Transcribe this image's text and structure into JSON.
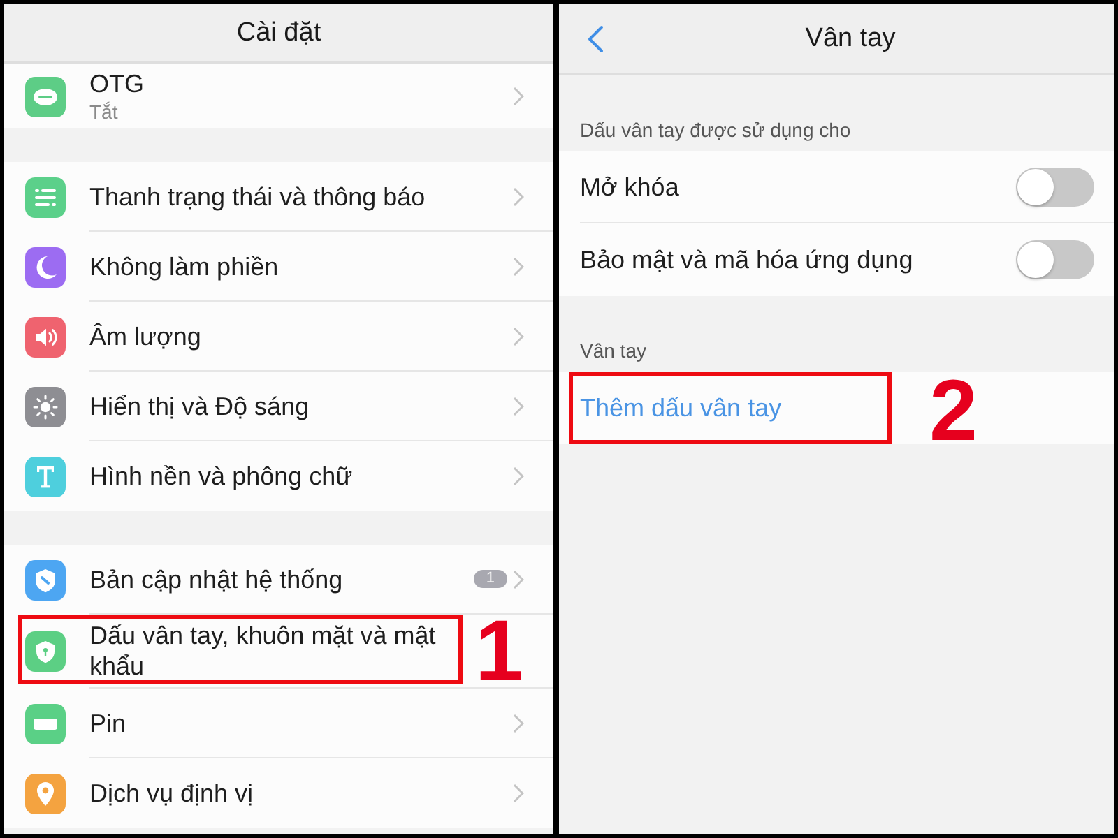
{
  "settings": {
    "title": "Cài đặt",
    "groups": [
      {
        "items": [
          {
            "label": "OTG",
            "sublabel": "Tắt",
            "color": "#5dcd86",
            "highlighted": false
          }
        ]
      },
      {
        "items": [
          {
            "label": "Thanh trạng thái và thông báo",
            "color": "#5bd08a",
            "highlighted": false
          },
          {
            "label": "Không làm phiền",
            "color": "#9c6cf2",
            "highlighted": false
          },
          {
            "label": "Âm lượng",
            "color": "#ef636f",
            "highlighted": false
          },
          {
            "label": "Hiển thị và Độ sáng",
            "color": "#8e8e93",
            "highlighted": false
          },
          {
            "label": "Hình nền và phông chữ",
            "color": "#4ecfdd",
            "highlighted": false
          }
        ]
      },
      {
        "items": [
          {
            "label": "Bản cập nhật hệ thống",
            "badge": "1",
            "color": "#4da6f2",
            "highlighted": false
          },
          {
            "label": "Dấu vân tay, khuôn mặt và mật khẩu",
            "color": "#5ccf84",
            "highlighted": true,
            "marker": "1"
          },
          {
            "label": "Pin",
            "color": "#5ad086",
            "highlighted": false
          },
          {
            "label": "Dịch vụ định vị",
            "color": "#f4a340",
            "highlighted": false
          }
        ]
      }
    ]
  },
  "fingerprint": {
    "title": "Vân tay",
    "sections": [
      {
        "header": "Dấu vân tay được sử dụng cho",
        "items": [
          {
            "kind": "toggle",
            "label": "Mở khóa",
            "on": false,
            "highlighted": false
          },
          {
            "kind": "toggle",
            "label": "Bảo mật và mã hóa ứng dụng",
            "on": false,
            "highlighted": false
          }
        ]
      },
      {
        "header": "Vân tay",
        "items": [
          {
            "kind": "action",
            "label": "Thêm dấu vân tay",
            "highlighted": true,
            "marker": "2"
          }
        ]
      }
    ]
  }
}
